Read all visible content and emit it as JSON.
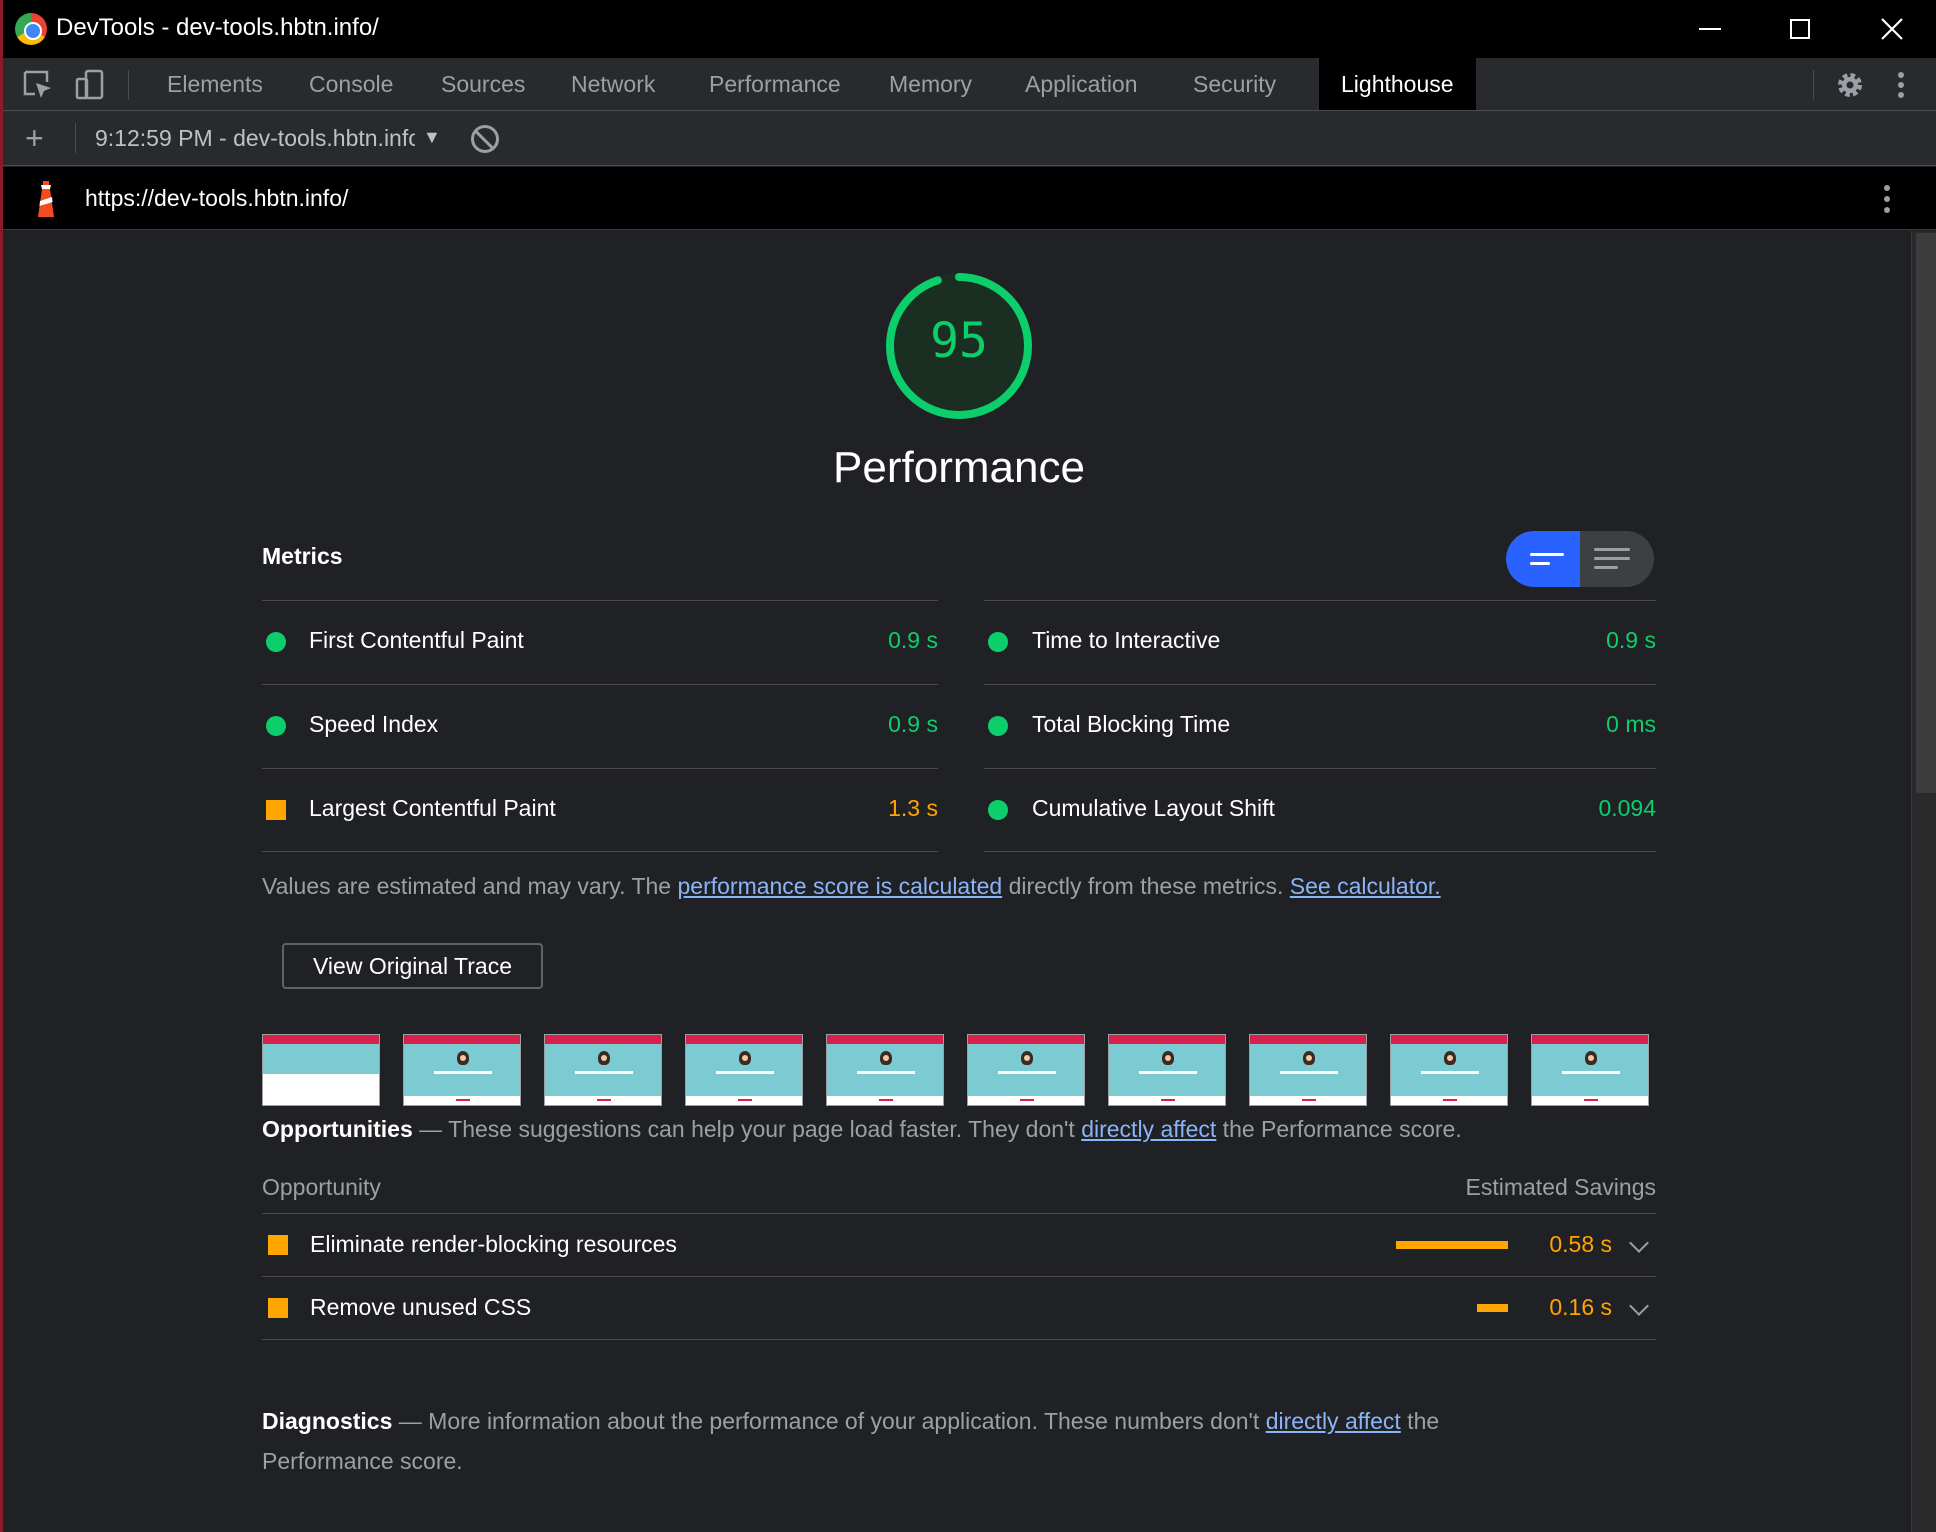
{
  "window": {
    "title": "DevTools - dev-tools.hbtn.info/"
  },
  "tabs": [
    {
      "label": "Elements"
    },
    {
      "label": "Console"
    },
    {
      "label": "Sources"
    },
    {
      "label": "Network"
    },
    {
      "label": "Performance"
    },
    {
      "label": "Memory"
    },
    {
      "label": "Application"
    },
    {
      "label": "Security"
    },
    {
      "label": "Lighthouse"
    }
  ],
  "toolbar": {
    "add_icon": "+",
    "report_select": "9:12:59 PM - dev-tools.hbtn.info/",
    "caret": "▼"
  },
  "urlbar": {
    "url": "https://dev-tools.hbtn.info/"
  },
  "report": {
    "score": "95",
    "category": "Performance",
    "metrics_heading": "Metrics",
    "metrics": [
      {
        "label": "First Contentful Paint",
        "value": "0.9 s",
        "status": "pass"
      },
      {
        "label": "Time to Interactive",
        "value": "0.9 s",
        "status": "pass"
      },
      {
        "label": "Speed Index",
        "value": "0.9 s",
        "status": "pass"
      },
      {
        "label": "Total Blocking Time",
        "value": "0 ms",
        "status": "pass"
      },
      {
        "label": "Largest Contentful Paint",
        "value": "1.3 s",
        "status": "average"
      },
      {
        "label": "Cumulative Layout Shift",
        "value": "0.094",
        "status": "pass"
      }
    ],
    "note_prefix": "Values are estimated and may vary. The ",
    "note_link1": "performance score is calculated",
    "note_middle": " directly from these metrics. ",
    "note_link2": "See calculator.",
    "trace_button": "View Original Trace",
    "opportunities_heading": "Opportunities",
    "opportunities_desc_prefix": " — These suggestions can help your page load faster. They don't ",
    "opportunities_link": "directly affect",
    "opportunities_desc_suffix": " the Performance score.",
    "opp_col_left": "Opportunity",
    "opp_col_right": "Estimated Savings",
    "opportunities": [
      {
        "label": "Eliminate render-blocking resources",
        "value": "0.58 s",
        "savings_fraction": 1.0
      },
      {
        "label": "Remove unused CSS",
        "value": "0.16 s",
        "savings_fraction": 0.28
      }
    ],
    "diagnostics_heading": "Diagnostics",
    "diagnostics_desc_prefix": " — More information about the performance of your application. These numbers don't ",
    "diagnostics_link": "directly affect",
    "diagnostics_desc_suffix": " the Performance score."
  },
  "colors": {
    "pass": "#0cce6b",
    "average": "#ffa400",
    "link": "#8ab4f8",
    "toggle_active": "#2962ff"
  },
  "icons": {
    "inspect": "inspect-element-icon",
    "device": "device-toolbar-icon",
    "settings": "gear-icon",
    "more": "more-vertical-icon",
    "block": "clear-block-icon",
    "lighthouse": "lighthouse-icon"
  }
}
